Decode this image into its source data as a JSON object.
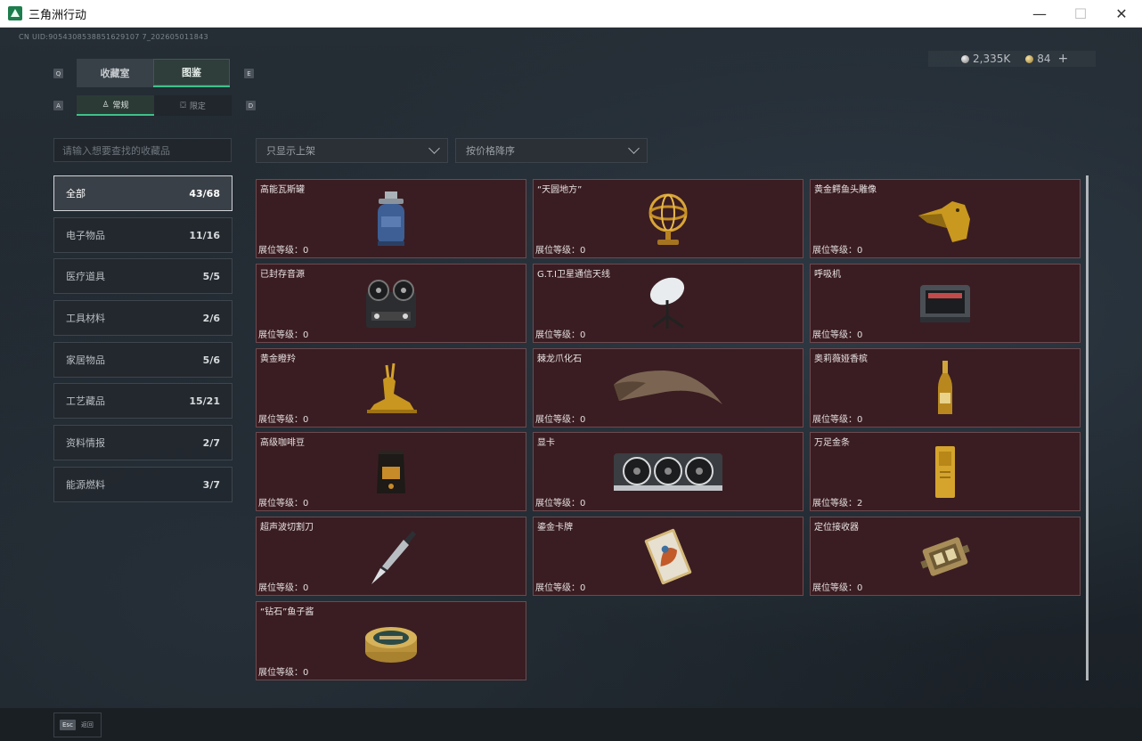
{
  "window": {
    "title": "三角洲行动",
    "minimize": "—",
    "maximize": "☐",
    "close": "✕"
  },
  "uid": "CN UID:9054308538851629107 7_202605011843",
  "currency": {
    "silver": "2,335K",
    "gold": "84",
    "add": "+"
  },
  "keys": {
    "q": "Q",
    "e": "E",
    "a": "A",
    "d": "D"
  },
  "main_tabs": [
    {
      "label": "收藏室"
    },
    {
      "label": "图鉴"
    }
  ],
  "sub_tabs": [
    {
      "label": "常规"
    },
    {
      "label": "限定"
    }
  ],
  "search": {
    "placeholder": "请输入想要查找的收藏品"
  },
  "filters": {
    "shelf": "只显示上架",
    "sort": "按价格降序"
  },
  "categories": [
    {
      "label": "全部",
      "count": "43/68"
    },
    {
      "label": "电子物品",
      "count": "11/16"
    },
    {
      "label": "医疗道具",
      "count": "5/5"
    },
    {
      "label": "工具材料",
      "count": "2/6"
    },
    {
      "label": "家居物品",
      "count": "5/6"
    },
    {
      "label": "工艺藏品",
      "count": "15/21"
    },
    {
      "label": "资料情报",
      "count": "2/7"
    },
    {
      "label": "能源燃料",
      "count": "3/7"
    }
  ],
  "level_prefix": "展位等级：",
  "items": [
    {
      "name": "高能瓦斯罐",
      "level": "0",
      "icon": "gas-canister-icon"
    },
    {
      "name": "“天圆地方”",
      "level": "0",
      "icon": "armillary-sphere-icon"
    },
    {
      "name": "黄金鳄鱼头雕像",
      "level": "0",
      "icon": "gold-crocodile-icon"
    },
    {
      "name": "已封存音源",
      "level": "0",
      "icon": "reel-recorder-icon"
    },
    {
      "name": "G.T.I卫星通信天线",
      "level": "0",
      "icon": "satellite-dish-icon"
    },
    {
      "name": "呼吸机",
      "level": "0",
      "icon": "ventilator-icon"
    },
    {
      "name": "黄金瞪羚",
      "level": "0",
      "icon": "gold-gazelle-icon"
    },
    {
      "name": "棘龙爪化石",
      "level": "0",
      "icon": "claw-fossil-icon"
    },
    {
      "name": "奥莉薇娅香槟",
      "level": "0",
      "icon": "champagne-icon"
    },
    {
      "name": "高级咖啡豆",
      "level": "0",
      "icon": "coffee-bag-icon"
    },
    {
      "name": "显卡",
      "level": "0",
      "icon": "graphics-card-icon"
    },
    {
      "name": "万足金条",
      "level": "2",
      "icon": "gold-bar-icon"
    },
    {
      "name": "超声波切割刀",
      "level": "0",
      "icon": "ultrasonic-cutter-icon"
    },
    {
      "name": "鎏金卡牌",
      "level": "0",
      "icon": "gilded-card-icon"
    },
    {
      "name": "定位接收器",
      "level": "0",
      "icon": "locator-receiver-icon"
    },
    {
      "name": "“钻石”鱼子酱",
      "level": "0",
      "icon": "caviar-tin-icon"
    }
  ],
  "bottom": {
    "esc_key": "Esc",
    "esc_label": "返回"
  }
}
